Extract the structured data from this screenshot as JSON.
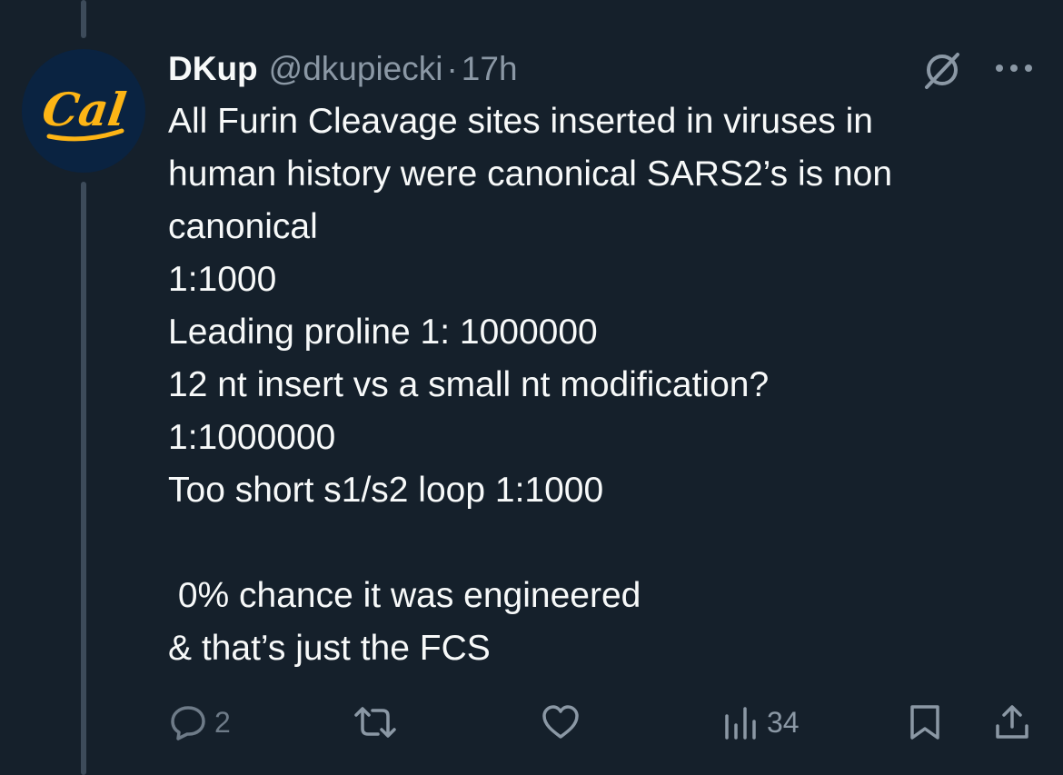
{
  "tweet": {
    "display_name": "DKup",
    "handle": "@dkupiecki",
    "separator": "·",
    "timestamp": "17h",
    "avatar_text": "Cal",
    "text": "All Furin Cleavage sites inserted in viruses in\nhuman history were canonical SARS2’s is non\ncanonical\n1:1000\nLeading proline 1: 1000000\n12 nt insert vs a small nt modification?\n1:1000000\nToo short s1/s2 loop 1:1000\n\n 0% chance it was engineered\n& that’s just the FCS"
  },
  "actions": {
    "reply_count": "2",
    "views_count": "34"
  },
  "icons": {
    "reply": "reply-icon",
    "retweet": "retweet-icon",
    "like": "heart-icon",
    "views": "views-icon",
    "bookmark": "bookmark-icon",
    "share": "share-icon",
    "grok": "grok-icon",
    "more": "more-icon"
  },
  "colors": {
    "background": "#15202b",
    "text": "#f7f9f9",
    "secondary": "#8b98a5",
    "avatar_bg": "#0a2341",
    "avatar_gold": "#fdb515"
  }
}
